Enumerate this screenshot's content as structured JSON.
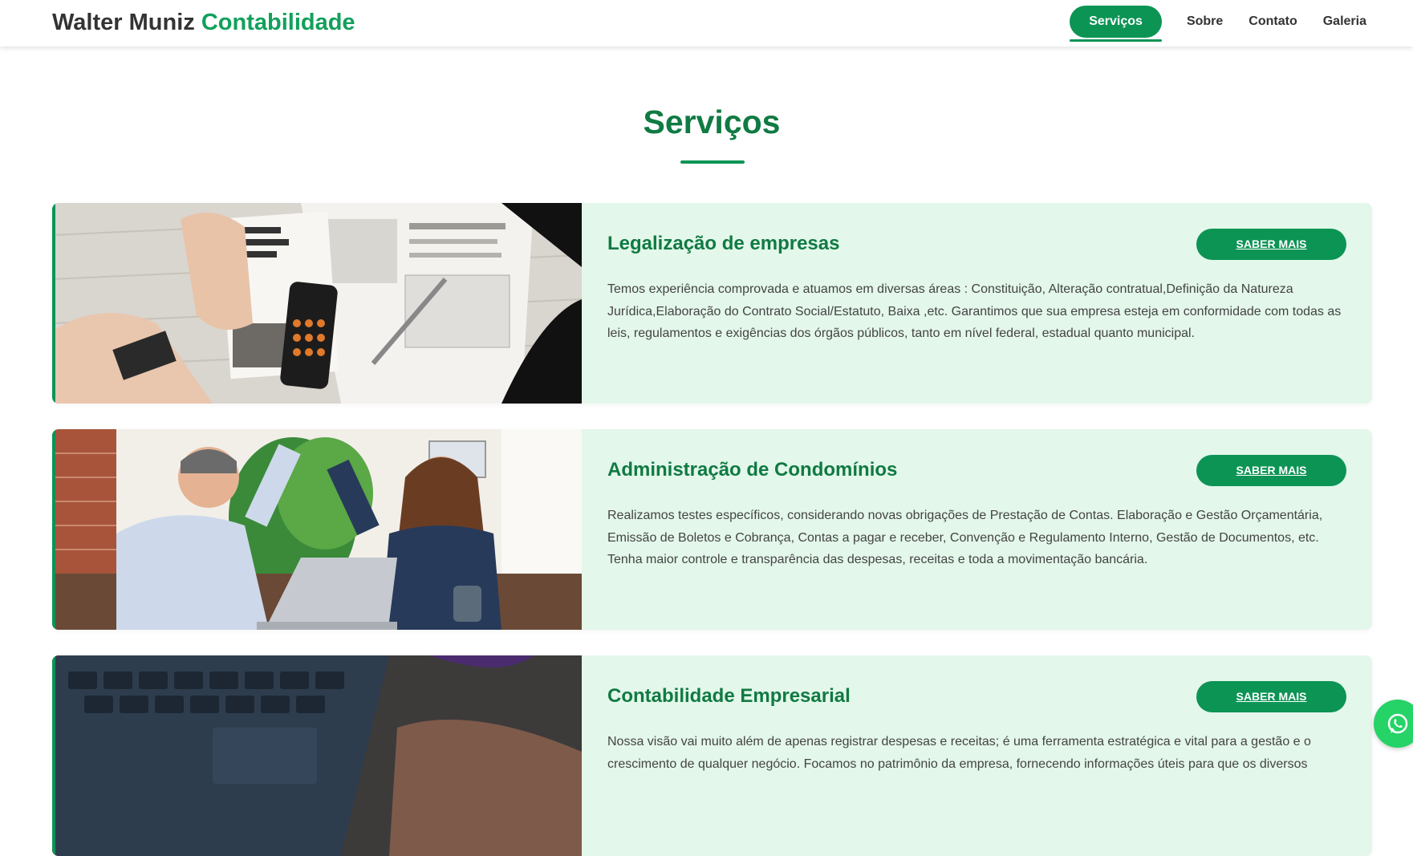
{
  "header": {
    "brand_name": "Walter Muniz",
    "brand_suffix": "Contabilidade",
    "nav": [
      "Serviços",
      "Sobre",
      "Contato",
      "Galeria"
    ]
  },
  "section": {
    "title": "Serviços"
  },
  "services": [
    {
      "title": "Legalização de empresas",
      "button": "SABER MAIS",
      "description": "Temos experiência comprovada e atuamos em diversas áreas : Constituição, Alteração contratual,Definição da Natureza Jurídica,Elaboração do Contrato Social/Estatuto, Baixa ,etc. Garantimos que sua empresa esteja em conformidade com todas as leis, regulamentos e exigências dos órgãos públicos, tanto em nível federal, estadual quanto municipal.",
      "image": "tax-documents-calculator-photo"
    },
    {
      "title": "Administração de Condomínios",
      "button": "SABER MAIS",
      "description": "Realizamos testes específicos, considerando novas obrigações de Prestação de Contas. Elaboração e Gestão Orçamentária, Emissão de Boletos e Cobrança, Contas a pagar e receber, Convenção e Regulamento Interno, Gestão de Documentos, etc. Tenha maior controle e transparência das despesas, receitas e toda a movimentação bancária.",
      "image": "colleagues-high-five-photo"
    },
    {
      "title": "Contabilidade Empresarial",
      "button": "SABER MAIS",
      "description": "Nossa visão vai muito além de apenas registrar despesas e receitas; é uma ferramenta estratégica e vital para a gestão e o crescimento de qualquer negócio. Focamos no patrimônio da empresa, fornecendo informações úteis para que os diversos",
      "image": "laptop-keyboard-photo"
    }
  ],
  "floating": {
    "icon": "whatsapp-icon"
  },
  "colors": {
    "brand_green": "#0c9455",
    "title_green": "#107a43",
    "card_background": "#e3f7ea"
  }
}
